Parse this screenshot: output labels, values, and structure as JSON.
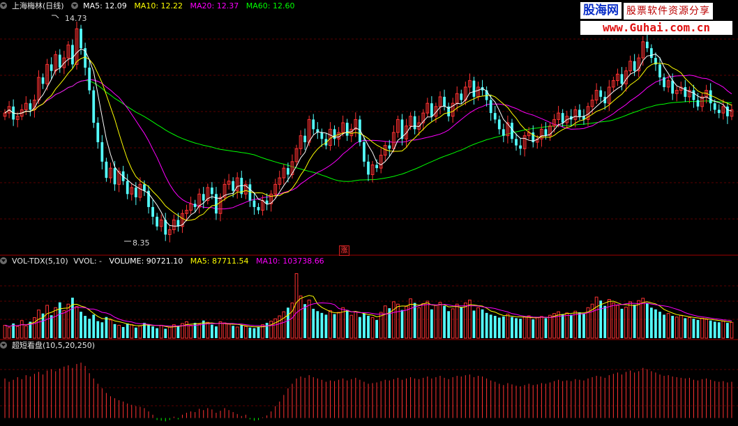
{
  "colors": {
    "up": "#ff3232",
    "down": "#54ffff",
    "ma5": "#ffffff",
    "ma10": "#ffff00",
    "ma20": "#ff00ff",
    "ma60": "#00ff00",
    "grid": "#5a0000",
    "panel_border": "#a00000"
  },
  "price_panel": {
    "stock_name": "上海梅林(日线)",
    "ma5": "MA5: 12.09",
    "ma10": "MA10: 12.22",
    "ma20": "MA20: 12.37",
    "ma60": "MA60: 12.60",
    "high_label": "14.73",
    "low_label": "8.35",
    "limit_up_marker": "涨"
  },
  "volume_panel": {
    "title": "VOL-TDX(5,10)",
    "vvol": "VVOL: -",
    "volume": "VOLUME: 90721.10",
    "ma5": "MA5: 87711.54",
    "ma10": "MA10: 103738.66"
  },
  "indicator_panel": {
    "title": "超短看盘(10,5,20,250)"
  },
  "watermark": {
    "name": "股海网",
    "slogan": "股票软件资源分享",
    "url": "www.Guhai.com.cn"
  },
  "chart_data": {
    "type": "candlestick",
    "price_ylim": [
      7.8,
      15.2
    ],
    "volume_ylim": [
      0,
      120000
    ],
    "indicator_ylim": [
      -10,
      100
    ],
    "close": [
      12.1,
      12.3,
      11.9,
      12.0,
      12.2,
      12.4,
      12.2,
      12.5,
      13.2,
      13.0,
      13.6,
      13.4,
      13.9,
      13.5,
      13.8,
      14.2,
      13.6,
      14.7,
      14.1,
      13.5,
      12.8,
      11.8,
      11.2,
      10.6,
      10.1,
      10.4,
      9.9,
      10.3,
      10.0,
      9.6,
      9.8,
      9.5,
      9.9,
      9.7,
      9.2,
      8.9,
      8.6,
      8.8,
      8.35,
      8.5,
      8.8,
      8.6,
      9.0,
      9.1,
      9.3,
      9.2,
      9.6,
      9.4,
      9.8,
      9.6,
      9.0,
      9.5,
      9.9,
      10.0,
      9.7,
      10.1,
      9.6,
      9.9,
      9.4,
      9.2,
      9.1,
      9.4,
      9.3,
      9.6,
      9.9,
      10.1,
      10.4,
      10.2,
      10.6,
      11.0,
      11.4,
      11.2,
      11.9,
      11.6,
      11.5,
      11.3,
      11.1,
      11.6,
      11.3,
      11.5,
      11.8,
      11.4,
      11.6,
      11.9,
      11.2,
      10.6,
      10.2,
      10.5,
      10.4,
      10.8,
      11.1,
      11.0,
      11.5,
      11.9,
      11.3,
      11.7,
      12.0,
      11.6,
      11.8,
      12.1,
      12.4,
      12.0,
      12.3,
      12.6,
      12.3,
      12.0,
      12.4,
      12.7,
      12.5,
      12.9,
      13.1,
      12.6,
      12.9,
      12.8,
      12.5,
      12.1,
      11.9,
      11.6,
      11.4,
      11.8,
      11.3,
      11.1,
      11.0,
      11.4,
      11.5,
      11.2,
      11.3,
      11.6,
      11.4,
      11.7,
      11.9,
      12.1,
      11.8,
      12.0,
      11.9,
      12.2,
      12.0,
      11.9,
      12.3,
      12.5,
      12.8,
      12.6,
      12.4,
      12.9,
      13.1,
      13.3,
      13.0,
      13.4,
      13.7,
      13.4,
      13.8,
      14.3,
      14.1,
      13.8,
      13.6,
      13.2,
      12.9,
      13.1,
      12.7,
      12.8,
      12.9,
      12.6,
      12.8,
      12.5,
      12.3,
      12.6,
      12.8,
      12.4,
      12.2,
      12.1,
      12.3,
      12.0,
      12.2
    ],
    "volume": [
      22000,
      18000,
      25000,
      20000,
      30000,
      21000,
      28000,
      35000,
      48000,
      42000,
      56000,
      39000,
      52000,
      61000,
      47000,
      58000,
      69000,
      54000,
      45000,
      38000,
      33000,
      40000,
      29000,
      27000,
      36000,
      31000,
      24000,
      22000,
      19000,
      25000,
      23000,
      18000,
      21000,
      26000,
      24000,
      20000,
      17000,
      22000,
      16000,
      19000,
      23000,
      21000,
      25000,
      28000,
      22000,
      26000,
      24000,
      30000,
      27000,
      23000,
      20000,
      28000,
      26000,
      24000,
      21000,
      19000,
      22000,
      20000,
      18000,
      17000,
      19000,
      23000,
      26000,
      29000,
      33000,
      38000,
      45000,
      52000,
      60000,
      110000,
      72000,
      58000,
      65000,
      50000,
      46000,
      43000,
      40000,
      47000,
      41000,
      44000,
      52000,
      48000,
      39000,
      45000,
      36000,
      42000,
      38000,
      35000,
      31000,
      44000,
      55000,
      51000,
      62000,
      58000,
      48000,
      54000,
      67000,
      60000,
      52000,
      59000,
      63000,
      49000,
      56000,
      61000,
      55000,
      46000,
      50000,
      58000,
      53000,
      60000,
      65000,
      47000,
      52000,
      49000,
      43000,
      40000,
      38000,
      35000,
      37000,
      41000,
      36000,
      34000,
      33000,
      36000,
      38000,
      32000,
      35000,
      37000,
      34000,
      39000,
      42000,
      45000,
      41000,
      43000,
      40000,
      46000,
      44000,
      42000,
      52000,
      58000,
      70000,
      64000,
      55000,
      66000,
      60000,
      56000,
      50000,
      53000,
      62000,
      57000,
      64000,
      68000,
      59000,
      52000,
      49000,
      45000,
      40000,
      42000,
      38000,
      36000,
      39000,
      34000,
      35000,
      33000,
      31000,
      34000,
      32000,
      30000,
      28000,
      27000,
      29000,
      26000,
      27000
    ],
    "indicator": [
      60,
      55,
      58,
      62,
      59,
      65,
      63,
      67,
      70,
      66,
      72,
      74,
      71,
      75,
      78,
      80,
      76,
      82,
      84,
      79,
      68,
      60,
      52,
      45,
      38,
      33,
      30,
      27,
      25,
      22,
      20,
      18,
      17,
      15,
      10,
      5,
      -3,
      -4,
      -5,
      -3,
      2,
      -2,
      5,
      8,
      10,
      9,
      14,
      12,
      15,
      13,
      8,
      11,
      15,
      12,
      9,
      6,
      3,
      5,
      -2,
      -4,
      -3,
      1,
      4,
      10,
      18,
      25,
      35,
      45,
      52,
      60,
      63,
      61,
      65,
      62,
      60,
      58,
      55,
      57,
      56,
      58,
      60,
      57,
      59,
      61,
      58,
      55,
      52,
      53,
      54,
      56,
      58,
      57,
      59,
      61,
      58,
      60,
      62,
      60,
      59,
      61,
      63,
      60,
      62,
      64,
      61,
      59,
      62,
      64,
      63,
      65,
      66,
      62,
      64,
      63,
      60,
      57,
      55,
      52,
      50,
      53,
      51,
      49,
      48,
      50,
      52,
      50,
      51,
      53,
      52,
      54,
      56,
      58,
      56,
      57,
      56,
      59,
      58,
      57,
      60,
      62,
      64,
      63,
      61,
      65,
      67,
      69,
      66,
      70,
      72,
      69,
      71,
      76,
      74,
      71,
      69,
      66,
      64,
      65,
      63,
      62,
      61,
      60,
      61,
      58,
      57,
      59,
      60,
      58,
      56,
      55,
      56,
      54,
      55
    ]
  }
}
